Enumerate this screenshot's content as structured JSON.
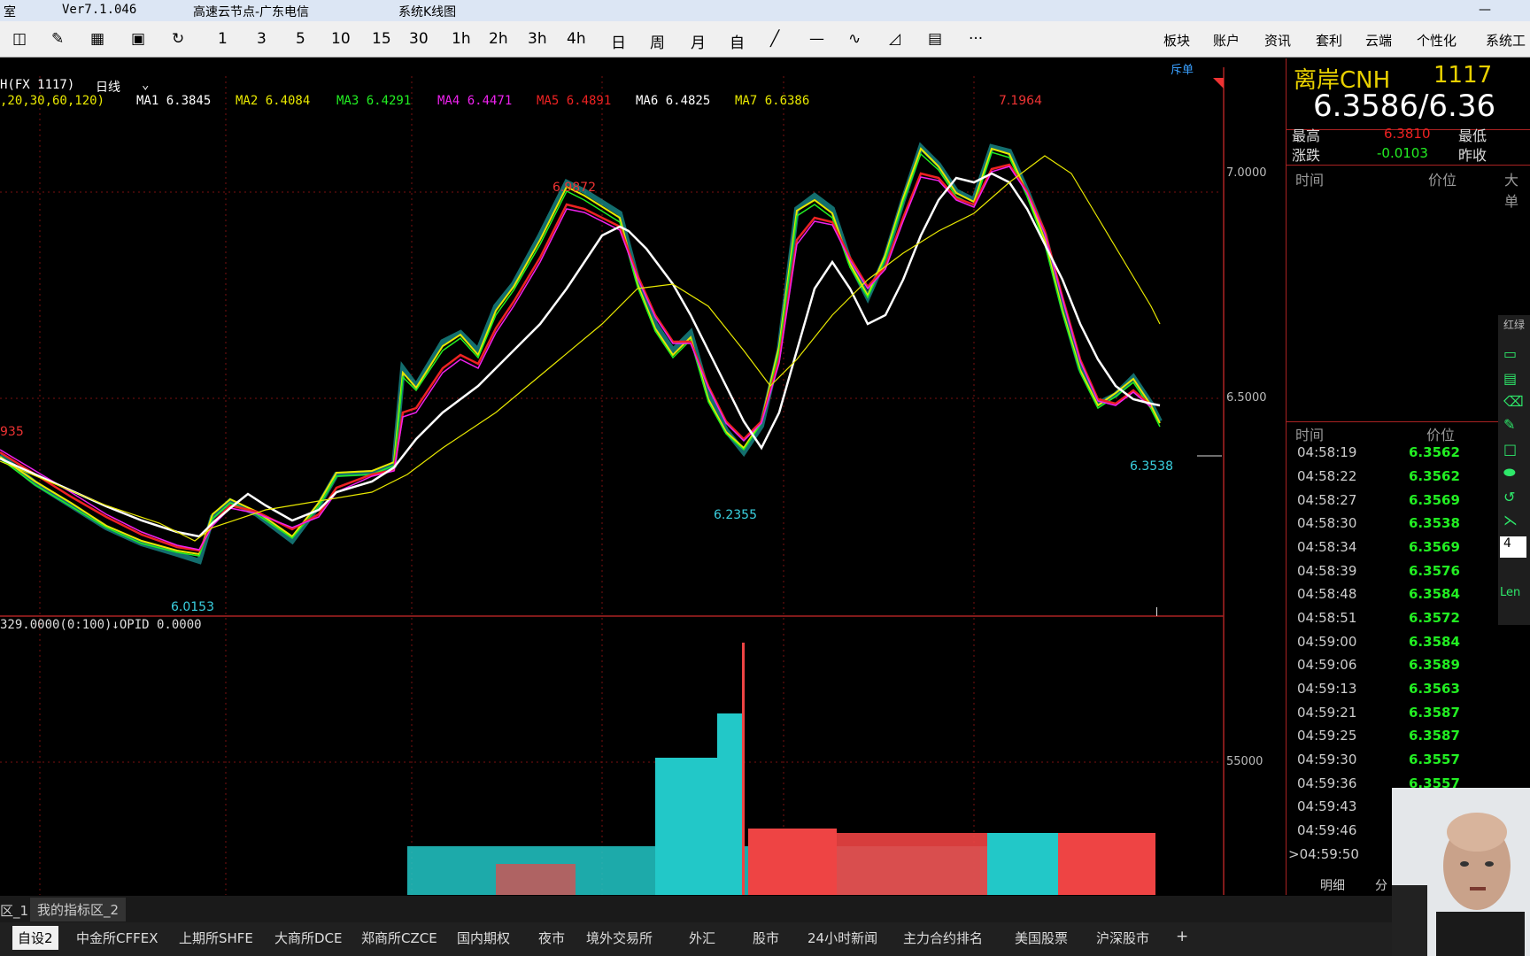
{
  "window": {
    "app_fragment": "室",
    "version": "Ver7.1.046",
    "server": "高速云节点-广东电信",
    "mode": "系统K线图",
    "minimize": "—"
  },
  "toolbar": {
    "items": [
      "1",
      "3",
      "5",
      "10",
      "15",
      "30",
      "1h",
      "2h",
      "3h",
      "4h",
      "日",
      "周",
      "月",
      "自"
    ],
    "menu": [
      "板块",
      "账户",
      "资讯",
      "套利",
      "云端",
      "个性化",
      "系统工"
    ],
    "more": "···"
  },
  "chart": {
    "symbol": "H(FX 1117)",
    "period": "日线",
    "ma_params": ",20,30,60,120)",
    "ma": [
      {
        "label": "MA1 6.3845",
        "color": "#ffffff"
      },
      {
        "label": "MA2 6.4084",
        "color": "#e8e800"
      },
      {
        "label": "MA3 6.4291",
        "color": "#22ee22"
      },
      {
        "label": "MA4 6.4471",
        "color": "#ee22ee"
      },
      {
        "label": "MA5 6.4891",
        "color": "#ee2222"
      },
      {
        "label": "MA6 6.4825",
        "color": "#ffffff"
      },
      {
        "label": "MA7 6.6386",
        "color": "#e8e800"
      }
    ],
    "corner_label": "斥单",
    "price_axis": [
      "7.0000",
      "6.5000"
    ],
    "volume_axis": "55000",
    "annotations": {
      "high_left": "935",
      "p1": "6.0153",
      "p2": "6.9872",
      "p3": "6.2355",
      "p4": "7.1964",
      "p5": "6.3538"
    },
    "sub_indicator": "329.0000(0:100)↓OPID 0.0000"
  },
  "quote": {
    "name": "离岸CNH",
    "code": "1117",
    "price": "6.3586/6.36",
    "high_label": "最高",
    "high_value": "6.3810",
    "low_label": "最低",
    "change_label": "涨跌",
    "change_value": "-0.0103",
    "prev_label": "昨收",
    "col_time": "时间",
    "col_price": "价位",
    "col_big": "大单",
    "ticks_header_time": "时间",
    "ticks_header_price": "价位",
    "ticks": [
      {
        "t": "04:58:19",
        "p": "6.3562"
      },
      {
        "t": "04:58:22",
        "p": "6.3562"
      },
      {
        "t": "04:58:27",
        "p": "6.3569"
      },
      {
        "t": "04:58:30",
        "p": "6.3538"
      },
      {
        "t": "04:58:34",
        "p": "6.3569"
      },
      {
        "t": "04:58:39",
        "p": "6.3576"
      },
      {
        "t": "04:58:48",
        "p": "6.3584"
      },
      {
        "t": "04:58:51",
        "p": "6.3572"
      },
      {
        "t": "04:59:00",
        "p": "6.3584"
      },
      {
        "t": "04:59:06",
        "p": "6.3589"
      },
      {
        "t": "04:59:13",
        "p": "6.3563"
      },
      {
        "t": "04:59:21",
        "p": "6.3587"
      },
      {
        "t": "04:59:25",
        "p": "6.3587"
      },
      {
        "t": "04:59:30",
        "p": "6.3557"
      },
      {
        "t": "04:59:36",
        "p": "6.3557"
      },
      {
        "t": "04:59:43",
        "p": ""
      },
      {
        "t": "04:59:46",
        "p": ""
      },
      {
        "t": ">04:59:50",
        "p": ""
      }
    ],
    "tab_detail": "明细",
    "tab_other": "分"
  },
  "side_tools": {
    "label_top": "红绿",
    "input_value": "4",
    "label_bottom": "Len"
  },
  "bottom": {
    "tabs_row1": [
      "区_1",
      "我的指标区_2"
    ],
    "tabs_row2": [
      "自设2",
      "中金所CFFEX",
      "上期所SHFE",
      "大商所DCE",
      "郑商所CZCE",
      "国内期权",
      "夜市",
      "境外交易所",
      "外汇",
      "股市",
      "24小时新闻",
      "主力合约排名",
      "美国股票",
      "沪深股市",
      "+"
    ]
  }
}
